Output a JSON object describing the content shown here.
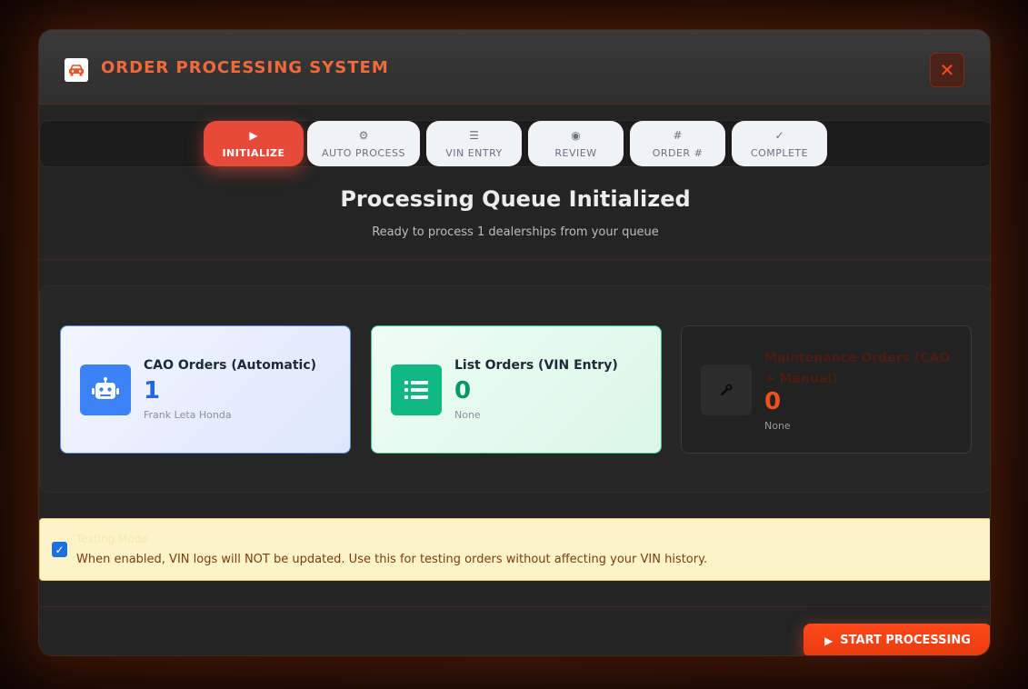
{
  "header": {
    "title": "ORDER PROCESSING SYSTEM",
    "logo_icon": "car-icon",
    "close_label": "✕"
  },
  "steps": [
    {
      "label": "INITIALIZE",
      "icon": "play-icon",
      "glyph": "▶",
      "active": true
    },
    {
      "label": "AUTO PROCESS",
      "icon": "robot-icon",
      "glyph": "⚙",
      "active": false
    },
    {
      "label": "VIN ENTRY",
      "icon": "list-icon",
      "glyph": "☰",
      "active": false
    },
    {
      "label": "REVIEW",
      "icon": "eye-icon",
      "glyph": "◉",
      "active": false
    },
    {
      "label": "ORDER #",
      "icon": "hash-icon",
      "glyph": "#",
      "active": false
    },
    {
      "label": "COMPLETE",
      "icon": "check-icon",
      "glyph": "✓",
      "active": false
    }
  ],
  "main": {
    "title": "Processing Queue Initialized",
    "subtitle": "Ready to process 1 dealerships from your queue"
  },
  "cards": {
    "cao": {
      "title": "CAO Orders (Automatic)",
      "count": "1",
      "note": "Frank Leta Honda",
      "icon": "robot-icon",
      "color": "#3b82f6"
    },
    "list": {
      "title": "List Orders (VIN Entry)",
      "count": "0",
      "note": "None",
      "icon": "list-icon",
      "color": "#10b981"
    },
    "maintenance": {
      "title": "Maintenance Orders (CAO + Manual)",
      "count": "0",
      "note": "None",
      "icon": "wrench-icon",
      "color": "#f0501e"
    }
  },
  "testing": {
    "label": "Testing Mode",
    "checked": true,
    "description": "When enabled, VIN logs will NOT be updated. Use this for testing orders without affecting your VIN history."
  },
  "footer": {
    "start_label": "START PROCESSING"
  },
  "colors": {
    "accent": "#f06a3c",
    "primary_button": "#ff4a1a",
    "active_step": "#e84a3a"
  }
}
